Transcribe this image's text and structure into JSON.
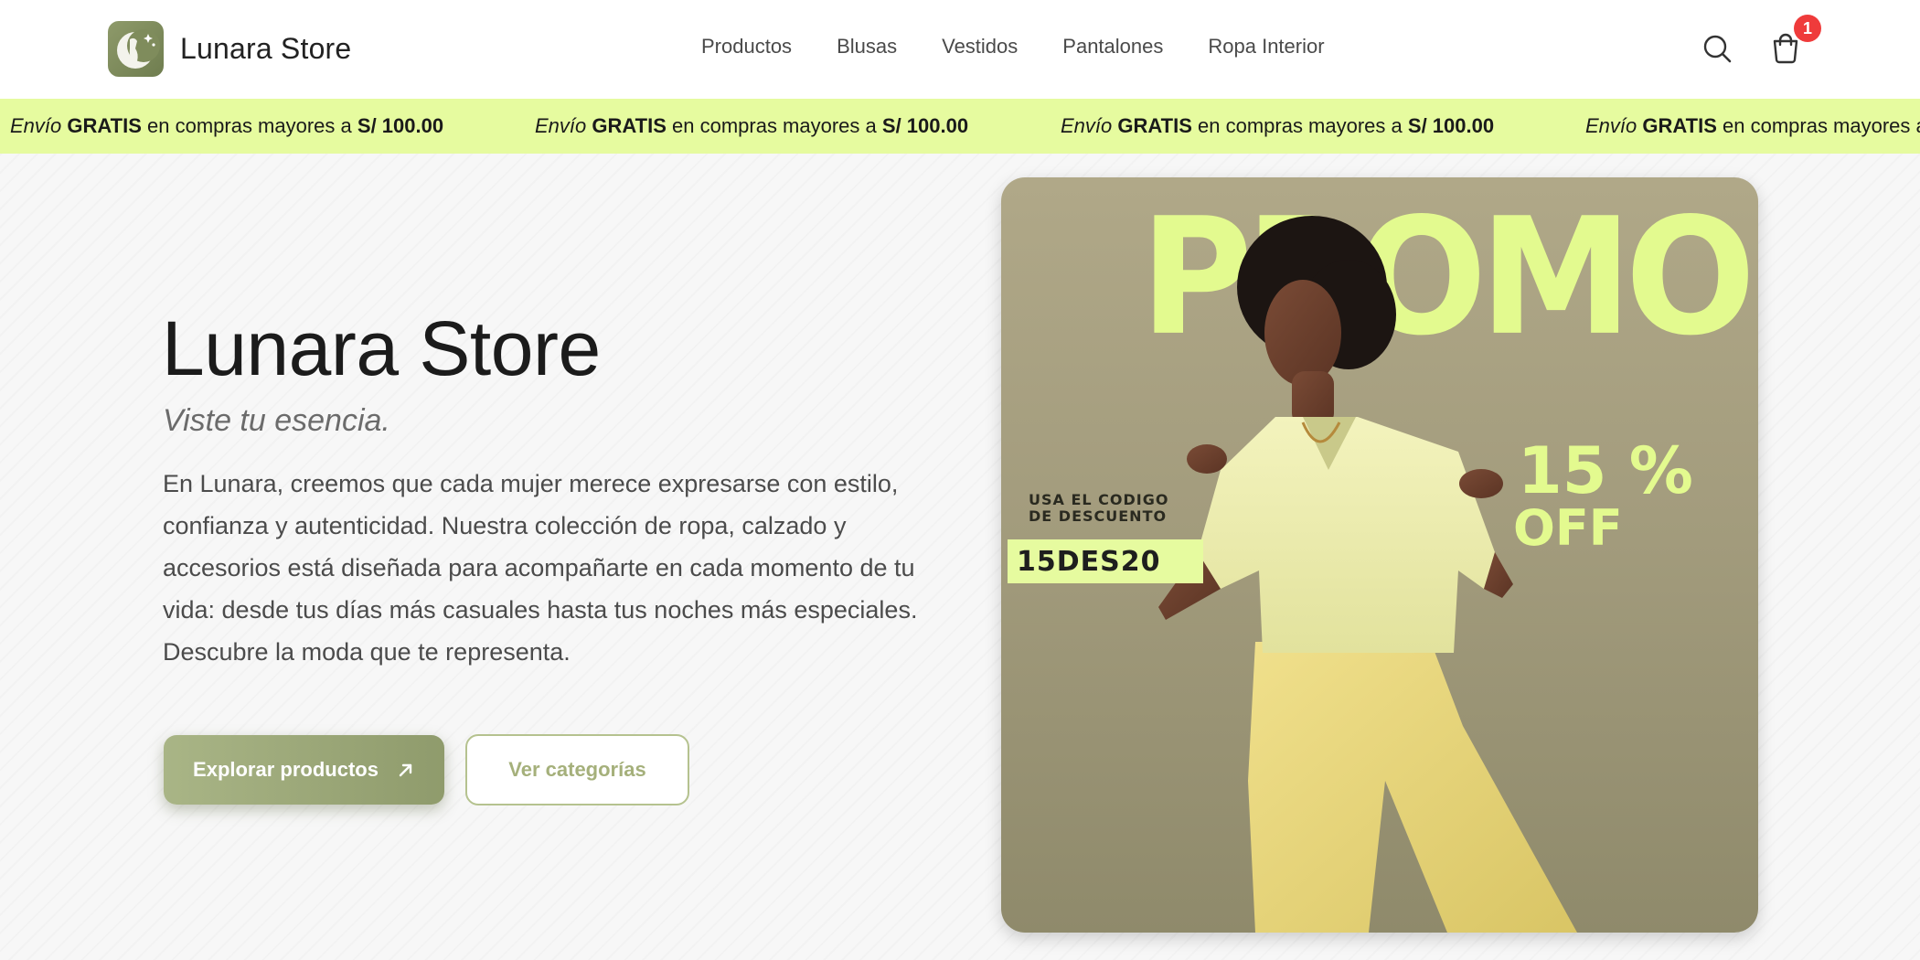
{
  "header": {
    "brand": "Lunara Store",
    "nav": [
      "Productos",
      "Blusas",
      "Vestidos",
      "Pantalones",
      "Ropa Interior"
    ],
    "cart_count": "1",
    "icons": [
      "logo-moon-icon",
      "search-icon",
      "cart-icon"
    ]
  },
  "ticker": {
    "prefix": "Envío",
    "bold1": "GRATIS",
    "middle": "en compras mayores a",
    "amount": "S/ 100.00"
  },
  "hero": {
    "title": "Lunara Store",
    "tagline": "Viste tu esencia.",
    "description": "En Lunara, creemos que cada mujer merece expresarse con estilo, confianza y autenticidad. Nuestra colección de ropa, calzado y accesorios está diseñada para acompañarte en cada momento de tu vida: desde tus días más casuales hasta tus noches más especiales. Descubre la moda que te representa.",
    "primary_button": "Explorar productos",
    "secondary_button": "Ver categorías"
  },
  "promo": {
    "headline": "PROMO",
    "discount": "15 %",
    "off": "OFF",
    "code_label": "USA EL CODIGO\nDE DESCUENTO",
    "code": "15DES20"
  },
  "colors": {
    "accent_lime": "#e6fb9f",
    "olive": "#8f9b6c",
    "badge_red": "#ef3b3b"
  }
}
